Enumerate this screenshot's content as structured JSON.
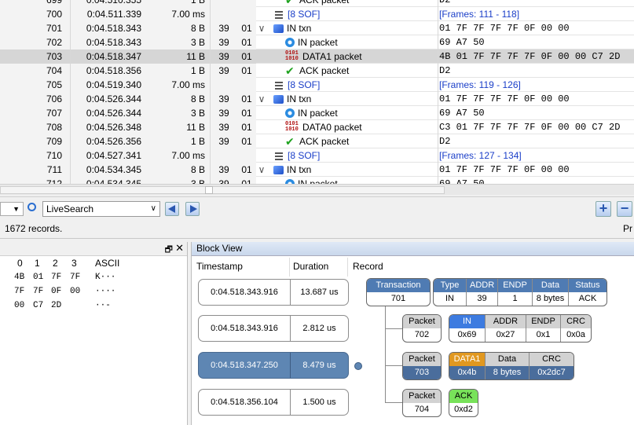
{
  "table": {
    "rows": [
      {
        "idx": "699",
        "time": "0:04.510.355",
        "len": "1 B",
        "addr": "",
        "endp": "",
        "exp": "",
        "icon": "ack-icon",
        "record": "ACK packet",
        "data": "D2",
        "sel": false,
        "indent": 2,
        "partial": true
      },
      {
        "idx": "700",
        "time": "0:04.511.339",
        "len": "7.00 ms",
        "addr": "",
        "endp": "",
        "exp": "",
        "icon": "sof-icon",
        "record": "[8 SOF]",
        "data": "[Frames: 111 - 118]",
        "sel": false,
        "indent": 1,
        "blue": true
      },
      {
        "idx": "701",
        "time": "0:04.518.343",
        "len": "8 B",
        "addr": "39",
        "endp": "01",
        "exp": "∨",
        "icon": "txn-icon",
        "record": "IN txn",
        "data": "01 7F 7F 7F 7F 0F 00 00",
        "sel": false,
        "indent": 1
      },
      {
        "idx": "702",
        "time": "0:04.518.343",
        "len": "3 B",
        "addr": "39",
        "endp": "01",
        "exp": "",
        "icon": "in-packet-icon",
        "record": "IN packet",
        "data": "69 A7 50",
        "sel": false,
        "indent": 2
      },
      {
        "idx": "703",
        "time": "0:04.518.347",
        "len": "11 B",
        "addr": "39",
        "endp": "01",
        "exp": "",
        "icon": "data-packet-icon",
        "record": "DATA1 packet",
        "data": "4B 01 7F 7F 7F 7F 0F 00 00 C7 2D",
        "sel": true,
        "indent": 2
      },
      {
        "idx": "704",
        "time": "0:04.518.356",
        "len": "1 B",
        "addr": "39",
        "endp": "01",
        "exp": "",
        "icon": "ack-icon",
        "record": "ACK packet",
        "data": "D2",
        "sel": false,
        "indent": 2
      },
      {
        "idx": "705",
        "time": "0:04.519.340",
        "len": "7.00 ms",
        "addr": "",
        "endp": "",
        "exp": "",
        "icon": "sof-icon",
        "record": "[8 SOF]",
        "data": "[Frames: 119 - 126]",
        "sel": false,
        "indent": 1,
        "blue": true
      },
      {
        "idx": "706",
        "time": "0:04.526.344",
        "len": "8 B",
        "addr": "39",
        "endp": "01",
        "exp": "∨",
        "icon": "txn-icon",
        "record": "IN txn",
        "data": "01 7F 7F 7F 7F 0F 00 00",
        "sel": false,
        "indent": 1
      },
      {
        "idx": "707",
        "time": "0:04.526.344",
        "len": "3 B",
        "addr": "39",
        "endp": "01",
        "exp": "",
        "icon": "in-packet-icon",
        "record": "IN packet",
        "data": "69 A7 50",
        "sel": false,
        "indent": 2
      },
      {
        "idx": "708",
        "time": "0:04.526.348",
        "len": "11 B",
        "addr": "39",
        "endp": "01",
        "exp": "",
        "icon": "data-packet-icon",
        "record": "DATA0 packet",
        "data": "C3 01 7F 7F 7F 7F 0F 00 00 C7 2D",
        "sel": false,
        "indent": 2
      },
      {
        "idx": "709",
        "time": "0:04.526.356",
        "len": "1 B",
        "addr": "39",
        "endp": "01",
        "exp": "",
        "icon": "ack-icon",
        "record": "ACK packet",
        "data": "D2",
        "sel": false,
        "indent": 2
      },
      {
        "idx": "710",
        "time": "0:04.527.341",
        "len": "7.00 ms",
        "addr": "",
        "endp": "",
        "exp": "",
        "icon": "sof-icon",
        "record": "[8 SOF]",
        "data": "[Frames: 127 - 134]",
        "sel": false,
        "indent": 1,
        "blue": true
      },
      {
        "idx": "711",
        "time": "0:04.534.345",
        "len": "8 B",
        "addr": "39",
        "endp": "01",
        "exp": "∨",
        "icon": "txn-icon",
        "record": "IN txn",
        "data": "01 7F 7F 7F 7F 0F 00 00",
        "sel": false,
        "indent": 1
      },
      {
        "idx": "712",
        "time": "0:04.534.345",
        "len": "3 B",
        "addr": "39",
        "endp": "01",
        "exp": "",
        "icon": "in-packet-icon",
        "record": "IN packet",
        "data": "69 A7 50",
        "sel": false,
        "indent": 2,
        "partial": true
      }
    ]
  },
  "toolbar": {
    "search_value": "LiveSearch"
  },
  "status": {
    "records": "1672 records.",
    "right": "Pr"
  },
  "hex": {
    "header": [
      "0",
      "1",
      "2",
      "3",
      "ASCII"
    ],
    "rows": [
      [
        "4B",
        "01",
        "7F",
        "7F",
        "K···"
      ],
      [
        "7F",
        "7F",
        "0F",
        "00",
        "····"
      ],
      [
        "00",
        "C7",
        "2D",
        "",
        "··-"
      ]
    ]
  },
  "block_view": {
    "title": "Block View",
    "columns": {
      "timestamp": "Timestamp",
      "duration": "Duration",
      "record": "Record"
    },
    "entries": [
      {
        "ts": "0:04.518.343.916",
        "dur": "13.687 us",
        "sel": false
      },
      {
        "ts": "0:04.518.343.916",
        "dur": "2.812 us",
        "sel": false
      },
      {
        "ts": "0:04.518.347.250",
        "dur": "8.479 us",
        "sel": true
      },
      {
        "ts": "0:04.518.356.104",
        "dur": "1.500 us",
        "sel": false
      }
    ],
    "transaction": {
      "k": "Transaction",
      "v": "701"
    },
    "txn_fields": [
      {
        "k": "Type",
        "v": "IN"
      },
      {
        "k": "ADDR",
        "v": "39"
      },
      {
        "k": "ENDP",
        "v": "1"
      },
      {
        "k": "Data",
        "v": "8 bytes"
      },
      {
        "k": "Status",
        "v": "ACK"
      }
    ],
    "packets": [
      {
        "k": "Packet",
        "v": "702",
        "fields": [
          {
            "k": "IN",
            "v": "0x69",
            "c": "blueb"
          },
          {
            "k": "ADDR",
            "v": "0x27"
          },
          {
            "k": "ENDP",
            "v": "0x1"
          },
          {
            "k": "CRC",
            "v": "0x0a"
          }
        ]
      },
      {
        "k": "Packet",
        "v": "703",
        "fields": [
          {
            "k": "DATA1",
            "v": "0x4b",
            "c": "orange"
          },
          {
            "k": "Data",
            "v": "8 bytes"
          },
          {
            "k": "CRC",
            "v": "0x2dc7"
          }
        ]
      },
      {
        "k": "Packet",
        "v": "704",
        "fields": [
          {
            "k": "ACK",
            "v": "0xd2",
            "c": "green"
          }
        ]
      }
    ]
  }
}
